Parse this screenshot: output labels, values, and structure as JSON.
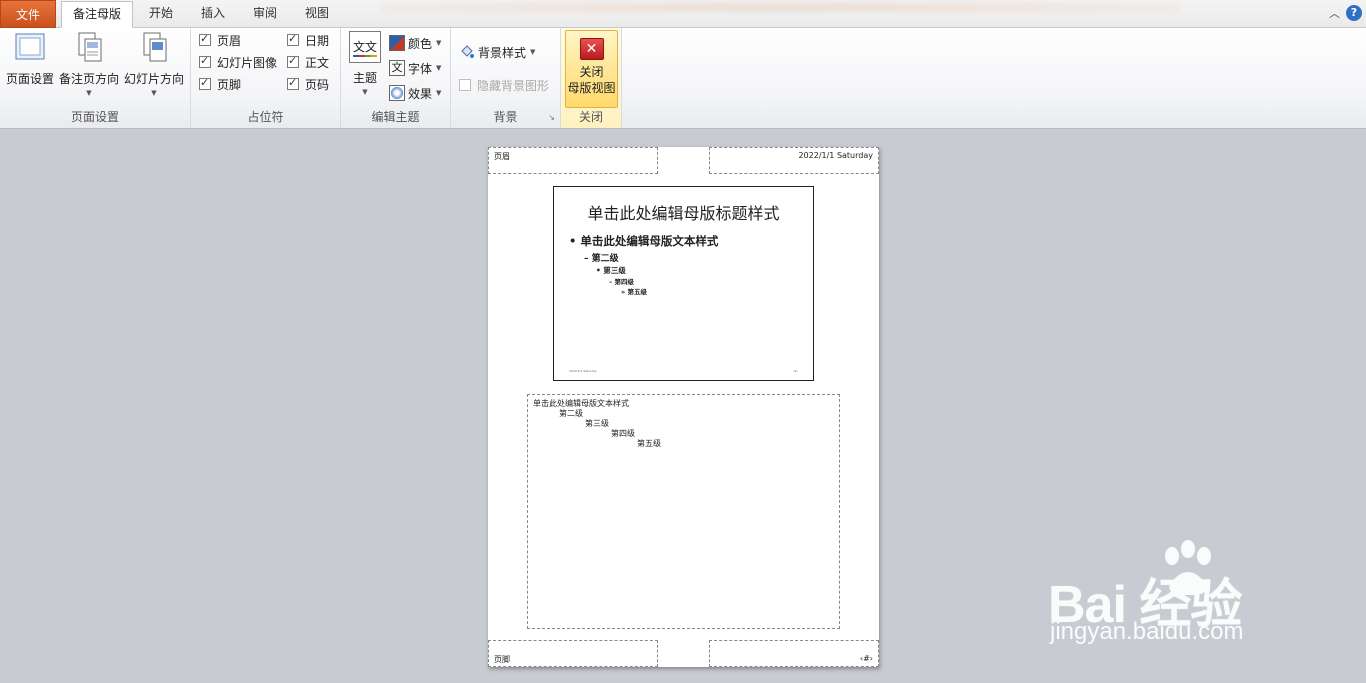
{
  "tabs": {
    "file": "文件",
    "active": "备注母版",
    "home": "开始",
    "insert": "插入",
    "review": "审阅",
    "view": "视图",
    "help": "?"
  },
  "ribbon": {
    "page_setup_group": {
      "label": "页面设置",
      "page_setup": "页面设置",
      "notes_orientation": "备注页方向",
      "slide_orientation": "幻灯片方向"
    },
    "placeholders_group": {
      "label": "占位符",
      "header": "页眉",
      "slide_image": "幻灯片图像",
      "footer": "页脚",
      "date": "日期",
      "body": "正文",
      "page_number": "页码"
    },
    "edit_theme_group": {
      "label": "编辑主题",
      "themes": "主题",
      "theme_icon_text": "文文",
      "colors": "颜色",
      "fonts": "字体",
      "effects": "效果"
    },
    "background_group": {
      "label": "背景",
      "background_styles": "背景样式",
      "hide_background": "隐藏背景图形"
    },
    "close_group": {
      "label": "关闭",
      "close_line1": "关闭",
      "close_line2": "母版视图"
    }
  },
  "notes_page": {
    "header": "页眉",
    "date": "2022/1/1 Saturday",
    "footer": "页脚",
    "page_number": "‹#›",
    "slide": {
      "title": "单击此处编辑母版标题样式",
      "level1": "• 单击此处编辑母版文本样式",
      "level2": "– 第二级",
      "level3": "• 第三级",
      "level4": "– 第四级",
      "level5": "» 第五级",
      "footer_date": "2022/1/1 Saturday",
      "footer_num": "‹#›"
    },
    "notes": {
      "level1": "单击此处编辑母版文本样式",
      "level2": "第二级",
      "level3": "第三级",
      "level4": "第四级",
      "level5": "第五级"
    }
  },
  "watermark": {
    "brand": "Bai  经验",
    "url": "jingyan.baidu.com"
  },
  "colors": {
    "file_tab": "#d35a23",
    "close_button": "#ffd96b",
    "canvas": "#c8ccd2"
  }
}
